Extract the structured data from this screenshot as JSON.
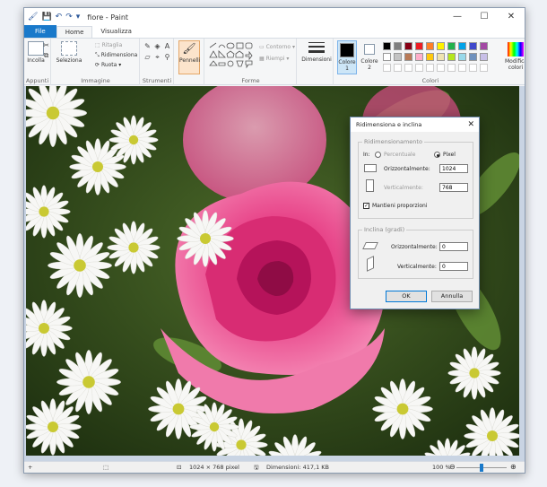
{
  "window": {
    "title": "fiore - Paint",
    "minimize": "—",
    "maximize": "☐",
    "close": "✕"
  },
  "qat": {
    "app_icon": "🖌",
    "save_icon": "💾",
    "undo_icon": "↶",
    "redo_icon": "↷",
    "customize_icon": "▾"
  },
  "tabs": [
    {
      "label": "File"
    },
    {
      "label": "Home"
    },
    {
      "label": "Visualizza"
    }
  ],
  "ribbon": {
    "clipboard": {
      "label": "Appunti",
      "paste": "Incolla"
    },
    "image": {
      "label": "Immagine",
      "select": "Seleziona",
      "crop": "Ritaglia",
      "resize": "Ridimensiona",
      "rotate": "Ruota"
    },
    "tools": {
      "label": "Strumenti"
    },
    "brushes": {
      "label": "Pennelli"
    },
    "shapes": {
      "label": "Forme",
      "outline": "Contorno",
      "fill": "Riempi"
    },
    "size": {
      "label": "Dimensioni"
    },
    "colors": {
      "label": "Colori",
      "color1": "Colore 1",
      "color2": "Colore 2",
      "edit": "Modifica colori",
      "palette_row1": [
        "#000000",
        "#7f7f7f",
        "#880015",
        "#ed1c24",
        "#ff7f27",
        "#fff200",
        "#22b14c",
        "#00a2e8",
        "#3f48cc",
        "#a349a4"
      ],
      "palette_row2": [
        "#ffffff",
        "#c3c3c3",
        "#b97a57",
        "#ffaec9",
        "#ffc90e",
        "#efe4b0",
        "#b5e61d",
        "#99d9ea",
        "#7092be",
        "#c8bfe7"
      ]
    }
  },
  "dialog": {
    "title": "Ridimensiona e inclina",
    "close": "✕",
    "resize_legend": "Ridimensionamento",
    "by_label": "In:",
    "percent_label": "Percentuale",
    "pixel_label": "Pixel",
    "horizontal_label": "Orizzontalmente:",
    "horizontal_value": "1024",
    "vertical_label": "Verticalmente:",
    "vertical_value": "768",
    "keep_ratio_label": "Mantieni proporzioni",
    "keep_ratio_check": "✓",
    "skew_legend": "Inclina (gradi)",
    "skew_horizontal_label": "Orizzontalmente:",
    "skew_horizontal_value": "0",
    "skew_vertical_label": "Verticalmente:",
    "skew_vertical_value": "0",
    "ok": "OK",
    "cancel": "Annulla"
  },
  "status": {
    "add_icon": "+",
    "selection_icon": "⬚",
    "size_icon": "⊡",
    "size": "1024 × 768 pixel",
    "file_icon": "🖫",
    "filesize": "Dimensioni: 417,1 KB",
    "zoom": "100 %",
    "zoom_out": "⊖",
    "zoom_in": "⊕",
    "zoom_level": 0.5
  }
}
